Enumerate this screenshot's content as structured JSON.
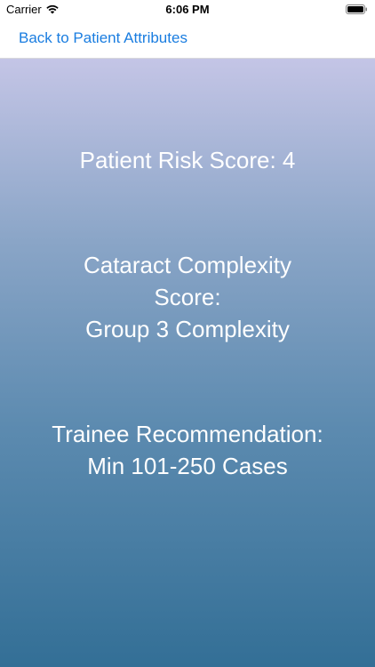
{
  "status_bar": {
    "carrier": "Carrier",
    "time": "6:06 PM"
  },
  "nav": {
    "back_label": "Back to Patient Attributes"
  },
  "results": {
    "risk": "Patient Risk Score: 4",
    "complexity_line1": "Cataract Complexity",
    "complexity_line2": "Score:",
    "complexity_line3": "Group 3 Complexity",
    "trainee_line1": "Trainee Recommendation:",
    "trainee_line2": "Min 101-250 Cases"
  },
  "colors": {
    "accent": "#1a7de0",
    "gradient_top": "#c4c5e6",
    "gradient_bottom": "#336f96"
  },
  "icons": [
    "wifi-icon",
    "battery-icon"
  ]
}
